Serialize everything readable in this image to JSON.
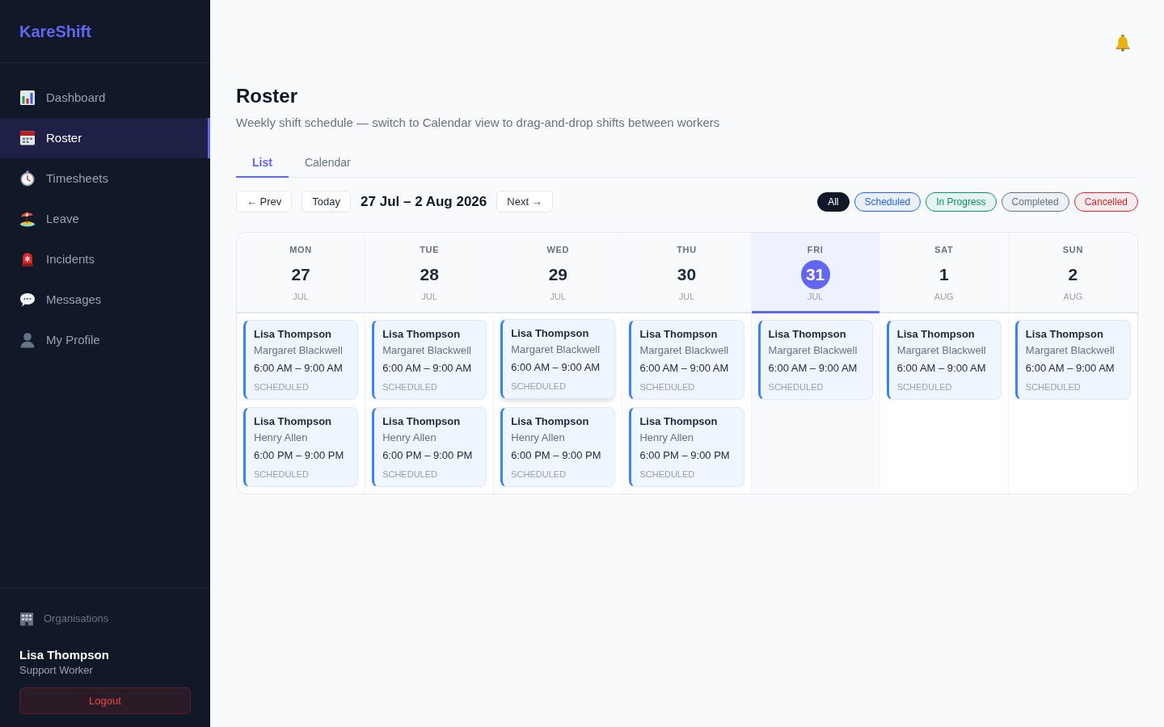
{
  "sidebar": {
    "logo": "KareShift",
    "nav": [
      {
        "label": "Dashboard",
        "selected": false
      },
      {
        "label": "Roster",
        "selected": true
      },
      {
        "label": "Timesheets",
        "selected": false
      },
      {
        "label": "Leave",
        "selected": false
      },
      {
        "label": "Incidents",
        "selected": false
      },
      {
        "label": "Messages",
        "selected": false
      },
      {
        "label": "My Profile",
        "selected": false
      }
    ],
    "organisations": "Organisations",
    "user": {
      "name": "Lisa Thompson",
      "role": "Support Worker"
    },
    "logout": "Logout"
  },
  "header": {
    "title": "Roster",
    "subtitle": "Weekly shift schedule — switch to Calendar view to drag-and-drop shifts between workers"
  },
  "tabs": [
    {
      "label": "List",
      "selected": true
    },
    {
      "label": "Calendar",
      "selected": false
    }
  ],
  "toolbar": {
    "prev": "← Prev",
    "today": "Today",
    "range": "27 Jul – 2 Aug 2026",
    "next": "Next →"
  },
  "filters": [
    {
      "label": "All",
      "selected": true,
      "color": "#111827"
    },
    {
      "label": "Scheduled",
      "selected": false,
      "color": "#2563eb"
    },
    {
      "label": "In Progress",
      "selected": false,
      "color": "#059669"
    },
    {
      "label": "Completed",
      "selected": false,
      "color": "#64748b"
    },
    {
      "label": "Cancelled",
      "selected": false,
      "color": "#dc2626"
    }
  ],
  "calendar": {
    "days": [
      {
        "weekday": "MON",
        "day": "27",
        "month": "JUL",
        "today": false,
        "shifts": [
          {
            "worker": "Lisa Thompson",
            "client": "Margaret Blackwell",
            "time": "6:00 AM – 9:00 AM",
            "status": "SCHEDULED",
            "hovered": false
          },
          {
            "worker": "Lisa Thompson",
            "client": "Henry Allen",
            "time": "6:00 PM – 9:00 PM",
            "status": "SCHEDULED",
            "hovered": false
          }
        ]
      },
      {
        "weekday": "TUE",
        "day": "28",
        "month": "JUL",
        "today": false,
        "shifts": [
          {
            "worker": "Lisa Thompson",
            "client": "Margaret Blackwell",
            "time": "6:00 AM – 9:00 AM",
            "status": "SCHEDULED",
            "hovered": false
          },
          {
            "worker": "Lisa Thompson",
            "client": "Henry Allen",
            "time": "6:00 PM – 9:00 PM",
            "status": "SCHEDULED",
            "hovered": false
          }
        ]
      },
      {
        "weekday": "WED",
        "day": "29",
        "month": "JUL",
        "today": false,
        "shifts": [
          {
            "worker": "Lisa Thompson",
            "client": "Margaret Blackwell",
            "time": "6:00 AM – 9:00 AM",
            "status": "SCHEDULED",
            "hovered": true
          },
          {
            "worker": "Lisa Thompson",
            "client": "Henry Allen",
            "time": "6:00 PM – 9:00 PM",
            "status": "SCHEDULED",
            "hovered": false
          }
        ]
      },
      {
        "weekday": "THU",
        "day": "30",
        "month": "JUL",
        "today": false,
        "shifts": [
          {
            "worker": "Lisa Thompson",
            "client": "Margaret Blackwell",
            "time": "6:00 AM – 9:00 AM",
            "status": "SCHEDULED",
            "hovered": false
          },
          {
            "worker": "Lisa Thompson",
            "client": "Henry Allen",
            "time": "6:00 PM – 9:00 PM",
            "status": "SCHEDULED",
            "hovered": false
          }
        ]
      },
      {
        "weekday": "FRI",
        "day": "31",
        "month": "JUL",
        "today": true,
        "shifts": [
          {
            "worker": "Lisa Thompson",
            "client": "Margaret Blackwell",
            "time": "6:00 AM – 9:00 AM",
            "status": "SCHEDULED",
            "hovered": false
          }
        ]
      },
      {
        "weekday": "SAT",
        "day": "1",
        "month": "AUG",
        "today": false,
        "shifts": [
          {
            "worker": "Lisa Thompson",
            "client": "Margaret Blackwell",
            "time": "6:00 AM – 9:00 AM",
            "status": "SCHEDULED",
            "hovered": false
          }
        ]
      },
      {
        "weekday": "SUN",
        "day": "2",
        "month": "AUG",
        "today": false,
        "shifts": [
          {
            "worker": "Lisa Thompson",
            "client": "Margaret Blackwell",
            "time": "6:00 AM – 9:00 AM",
            "status": "SCHEDULED",
            "hovered": false
          }
        ]
      }
    ]
  }
}
